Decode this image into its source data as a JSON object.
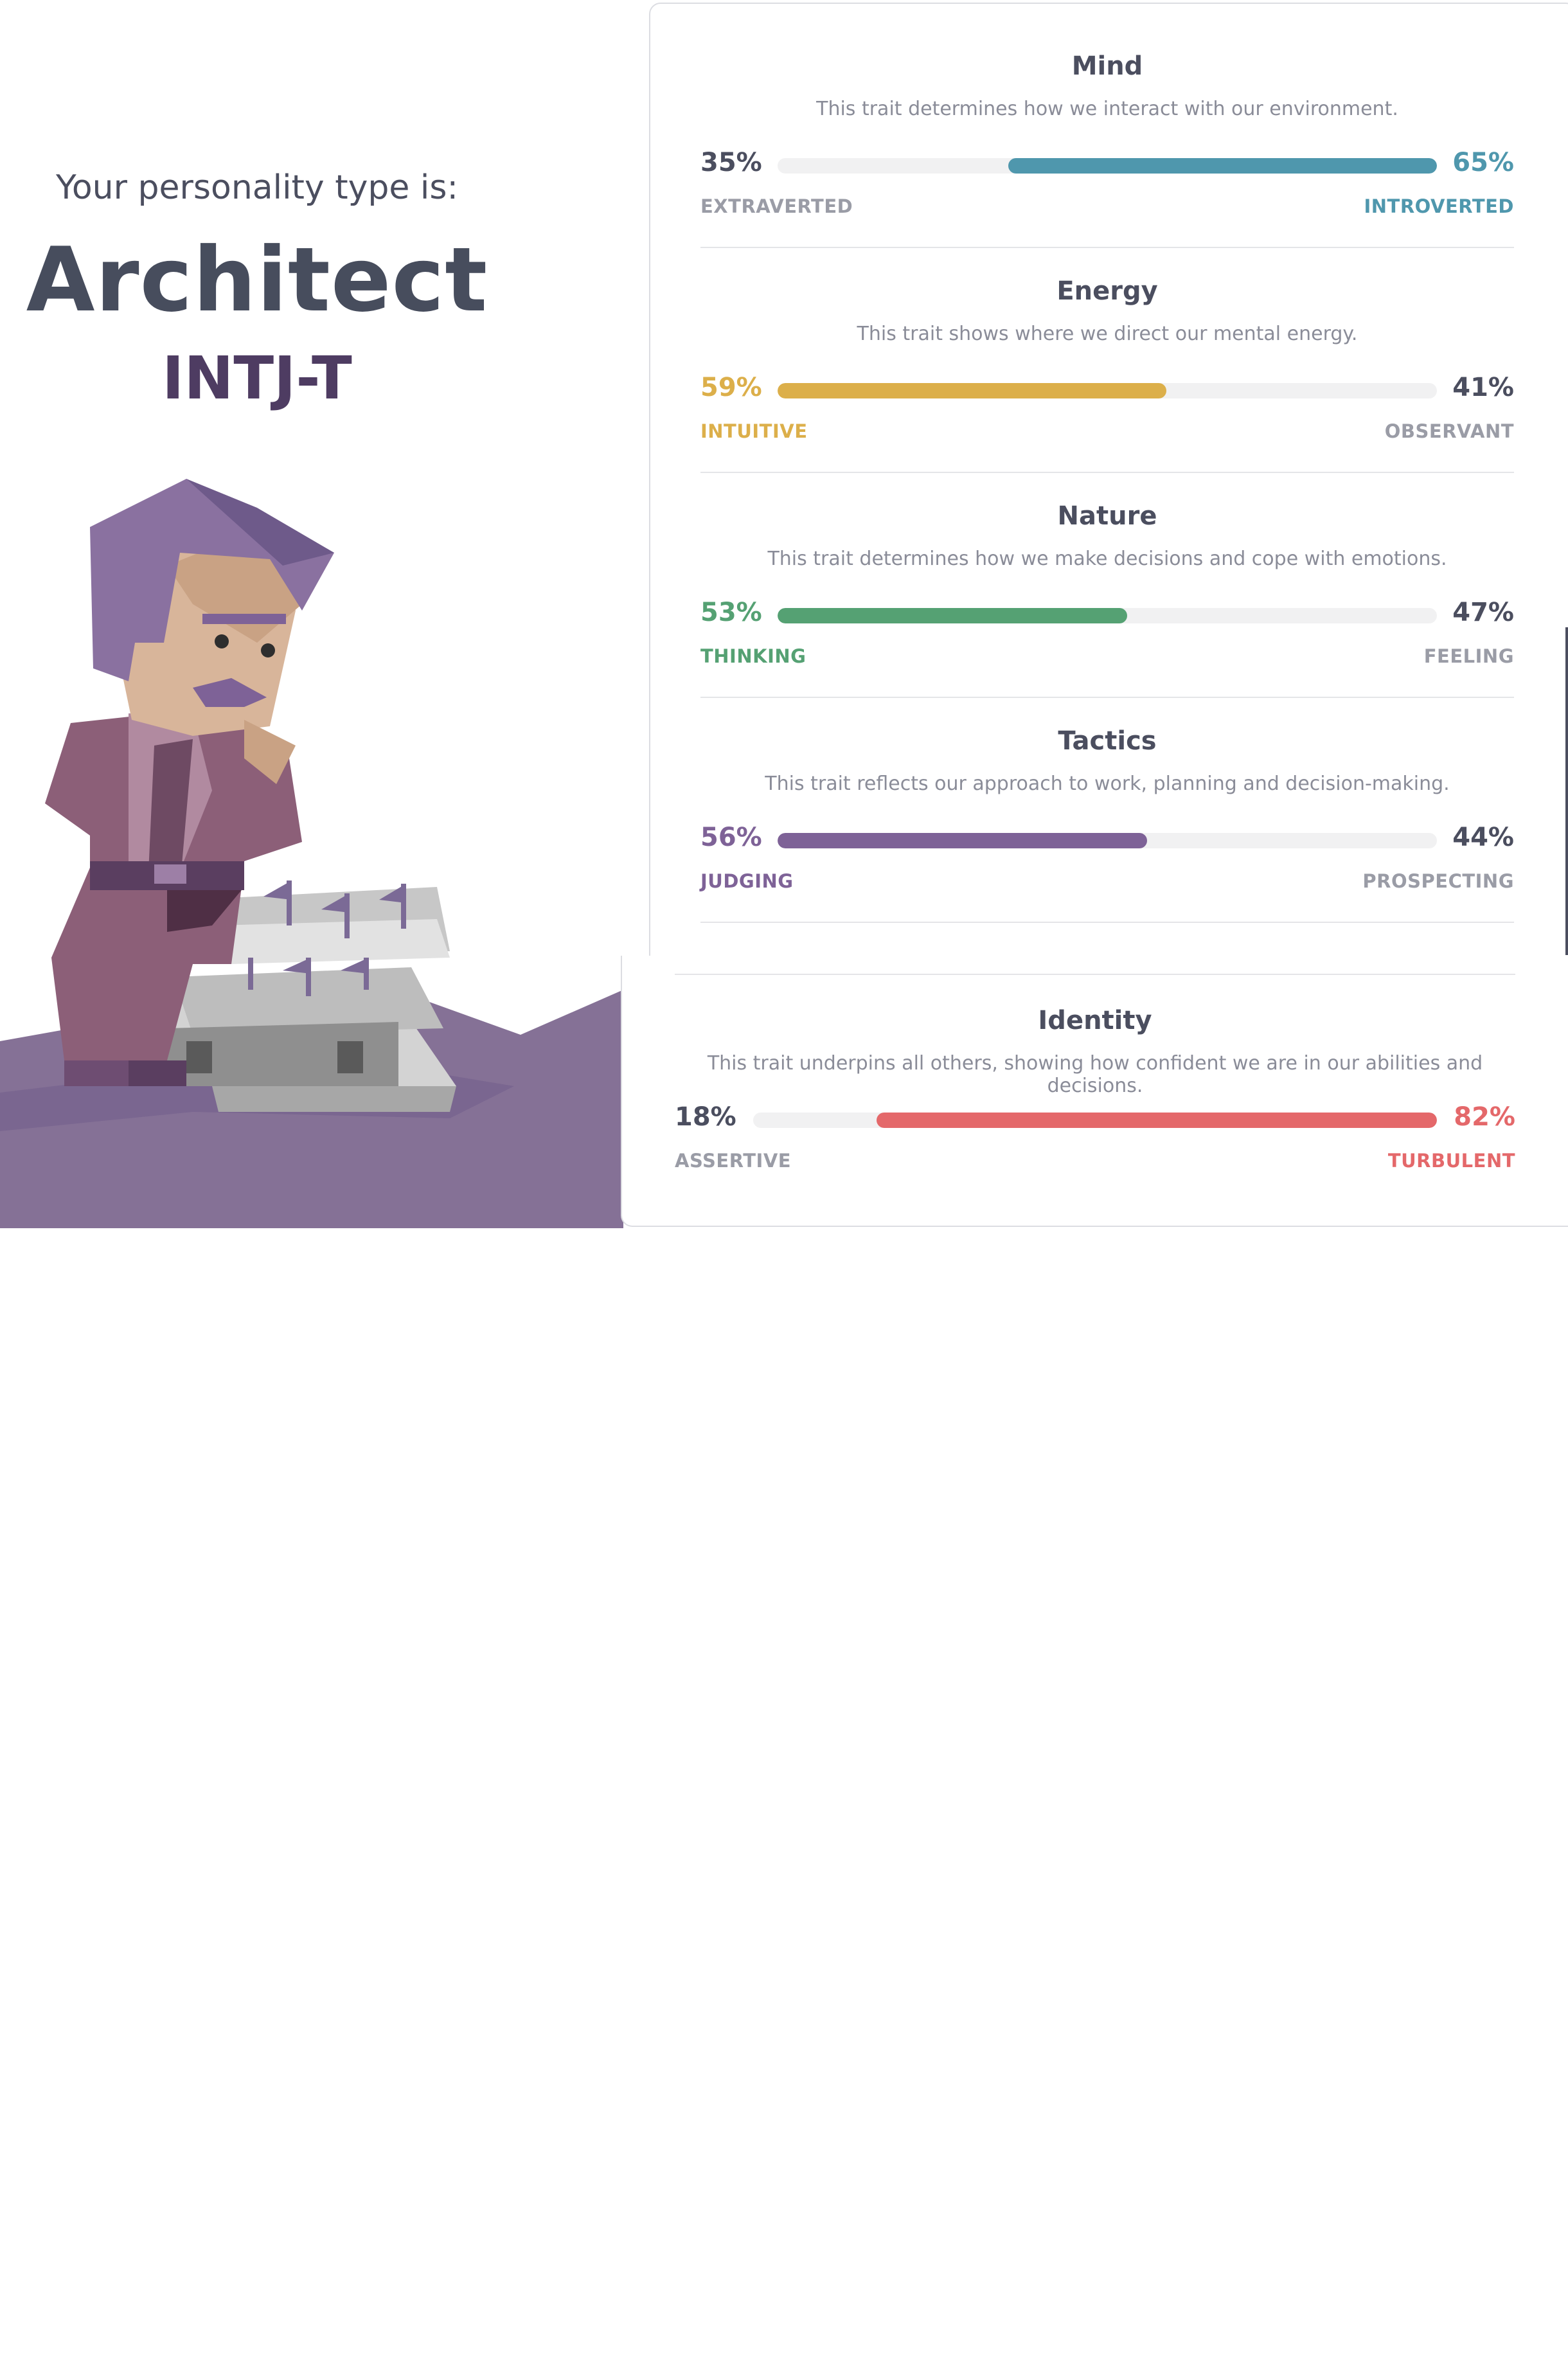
{
  "header": {
    "intro": "Your personality type is:",
    "type_name": "Architect",
    "type_code": "INTJ-T"
  },
  "illustration": {
    "name": "architect-character-chess-illustration",
    "colors": {
      "ground": "#857196",
      "skin": "#d8b59a",
      "hair": "#8a71a0",
      "suit": "#8c5f78",
      "board": "#b9b9b9"
    }
  },
  "traits": [
    {
      "title": "Mind",
      "description": "This trait determines how we interact with our environment.",
      "left_pct": "35%",
      "right_pct": "65%",
      "left_label": "EXTRAVERTED",
      "right_label": "INTROVERTED",
      "dominant": "right",
      "value": 0.65,
      "color": "#4f97ad"
    },
    {
      "title": "Energy",
      "description": "This trait shows where we direct our mental energy.",
      "left_pct": "59%",
      "right_pct": "41%",
      "left_label": "INTUITIVE",
      "right_label": "OBSERVANT",
      "dominant": "left",
      "value": 0.59,
      "color": "#dcaf4a"
    },
    {
      "title": "Nature",
      "description": "This trait determines how we make decisions and cope with emotions.",
      "left_pct": "53%",
      "right_pct": "47%",
      "left_label": "THINKING",
      "right_label": "FEELING",
      "dominant": "left",
      "value": 0.53,
      "color": "#55a173"
    },
    {
      "title": "Tactics",
      "description": "This trait reflects our approach to work, planning and decision-making.",
      "left_pct": "56%",
      "right_pct": "44%",
      "left_label": "JUDGING",
      "right_label": "PROSPECTING",
      "dominant": "left",
      "value": 0.56,
      "color": "#7e6297"
    }
  ],
  "identity": {
    "title": "Identity",
    "description": "This trait underpins all others, showing how confident we are in our abilities and decisions.",
    "left_pct": "18%",
    "right_pct": "82%",
    "left_label": "ASSERTIVE",
    "right_label": "TURBULENT",
    "dominant": "right",
    "value": 0.82,
    "color": "#e4686a"
  },
  "neutral_color": "#4b4e5f",
  "muted_label_color": "#9a9ca6"
}
